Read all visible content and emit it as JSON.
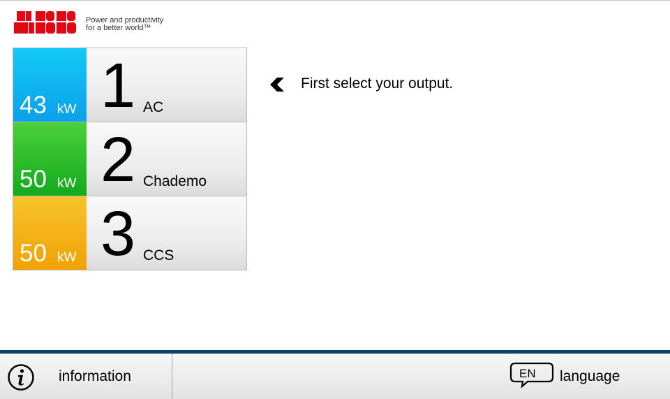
{
  "brand": {
    "logo_text": "ABB",
    "tagline_line1": "Power and productivity",
    "tagline_line2": "for a better world™",
    "color": "#e30613"
  },
  "outputs": [
    {
      "number": "1",
      "type": "AC",
      "power": "43",
      "unit": "kW",
      "color": "#0aa1e8"
    },
    {
      "number": "2",
      "type": "Chademo",
      "power": "50",
      "unit": "kW",
      "color": "#12ab1d"
    },
    {
      "number": "3",
      "type": "CCS",
      "power": "50",
      "unit": "kW",
      "color": "#f0a205"
    }
  ],
  "hint": {
    "icon": "chevron-left-icon",
    "text": "First select your output."
  },
  "footer": {
    "accent": "#0b4468",
    "info": {
      "icon": "info-icon",
      "label": "information"
    },
    "language": {
      "icon": "speech-bubble-icon",
      "code": "EN",
      "label": "language"
    }
  }
}
